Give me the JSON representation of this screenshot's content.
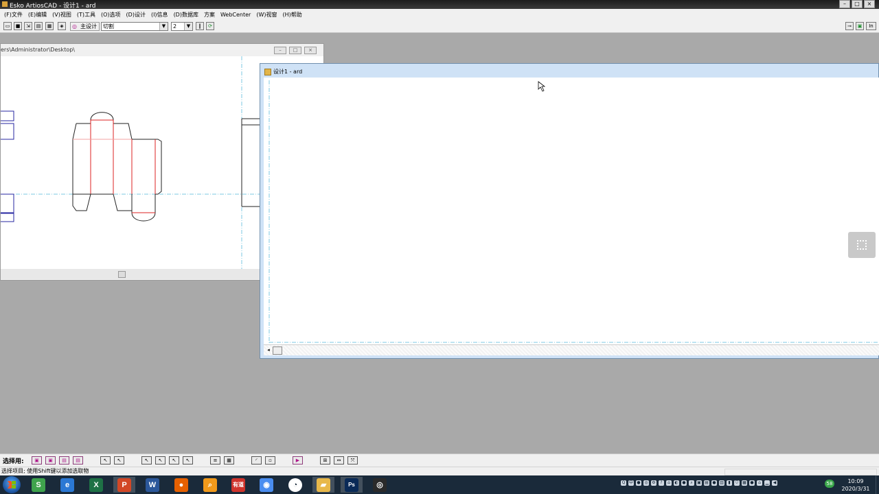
{
  "app": {
    "window_title": "Esko ArtiosCAD - 设计1 - ard",
    "controls": {
      "minimize": "–",
      "maximize": "□",
      "close": "×"
    }
  },
  "menubar": {
    "items": [
      "(F)文件",
      "(E)编辑",
      "(V)视图",
      "(T)工具",
      "(O)选项",
      "(D)设计",
      "(I)信息",
      "(D)数据库",
      "方案",
      "WebCenter",
      "(W)视窗",
      "(H)帮助"
    ]
  },
  "toolbar": {
    "main_design_label": "主设计",
    "line_type_value": "切割",
    "pointage_value": "2",
    "right_buttons": [
      "⊸",
      "▣",
      "In"
    ]
  },
  "window_one": {
    "title": "ers\\Administrator\\Desktop\\",
    "controls": [
      "–",
      "□",
      "×"
    ]
  },
  "window_two": {
    "title": "设计1 - ard"
  },
  "selection_bar": {
    "label": "选择用:"
  },
  "status": {
    "text": "选择项目; 使用Shift键以添加选取物"
  },
  "taskbar": {
    "apps": [
      {
        "name": "360-security-icon",
        "glyph": "S",
        "color": "#3fa34d"
      },
      {
        "name": "ie-icon",
        "glyph": "e",
        "color": "#2b78d4"
      },
      {
        "name": "excel-icon",
        "glyph": "X",
        "color": "#1e7145"
      },
      {
        "name": "powerpoint-icon",
        "glyph": "P",
        "color": "#d24726"
      },
      {
        "name": "word-icon",
        "glyph": "W",
        "color": "#2b579a"
      },
      {
        "name": "firefox-icon",
        "glyph": "●",
        "color": "#e66000"
      },
      {
        "name": "search-app-icon",
        "glyph": "⌕",
        "color": "#f29a1b"
      },
      {
        "name": "youdao-icon",
        "glyph": "有道",
        "color": "#d0342c"
      },
      {
        "name": "chrome-icon",
        "glyph": "◉",
        "color": "#4a8df0"
      },
      {
        "name": "clock-app-icon",
        "glyph": "◔",
        "color": "#ffffff"
      },
      {
        "name": "artioscad-icon",
        "glyph": "▰",
        "color": "#e8b84a"
      },
      {
        "name": "photoshop-icon",
        "glyph": "Ps",
        "color": "#0a2a57"
      },
      {
        "name": "obs-icon",
        "glyph": "◎",
        "color": "#2a2a2a"
      }
    ],
    "tray_badge": "58",
    "time": "10:09",
    "date": "2020/3/31"
  }
}
